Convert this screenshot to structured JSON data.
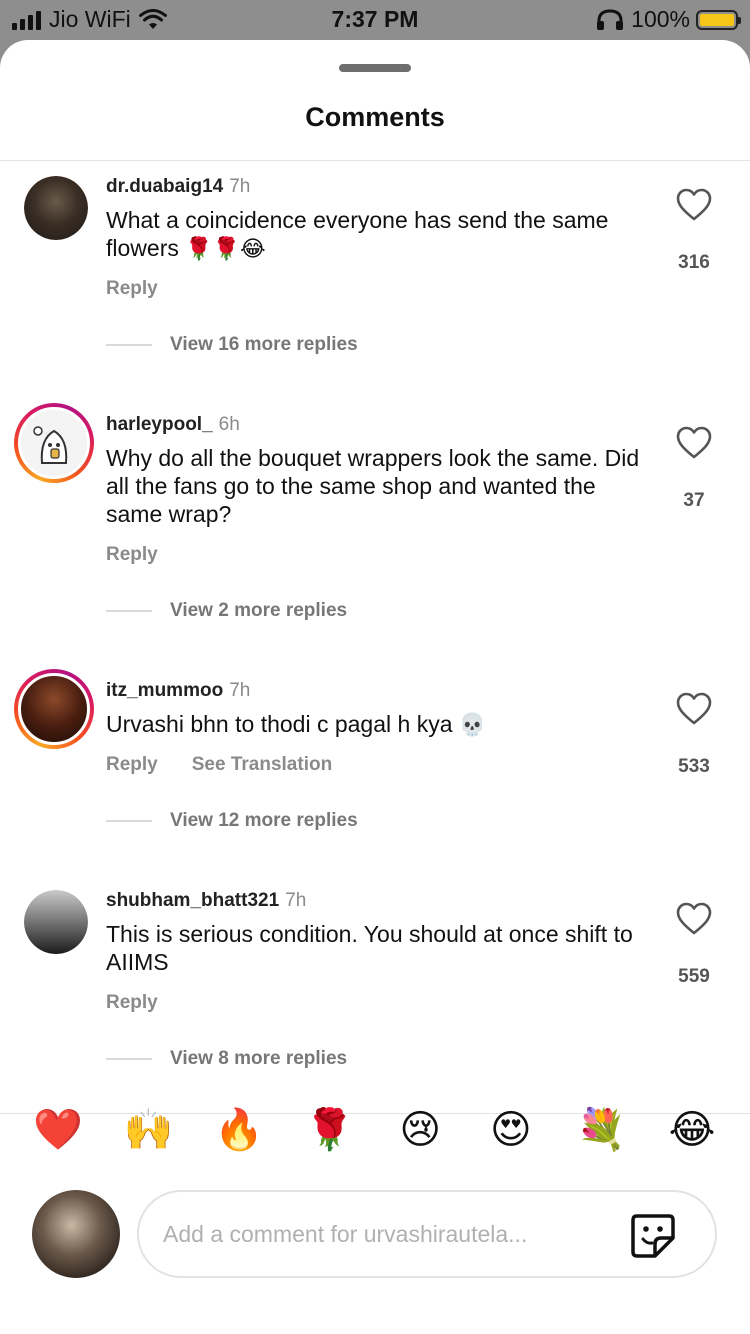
{
  "status_bar": {
    "carrier": "Jio WiFi",
    "time": "7:37 PM",
    "battery": "100%",
    "battery_color": "#f5c518"
  },
  "sheet": {
    "title": "Comments"
  },
  "comments": [
    {
      "user": "dr.duabaig14",
      "time": "7h",
      "text": "What a coincidence everyone has  send the same flowers",
      "emojis": "🌹🌹😂",
      "reply_label": "Reply",
      "likes": "316",
      "view_replies": "View 16 more replies",
      "has_story_ring": false
    },
    {
      "user": "harleypool_",
      "time": "6h",
      "text": "Why do all the bouquet wrappers look the same. Did all the fans go to the same shop and wanted the same wrap?",
      "emojis": "",
      "reply_label": "Reply",
      "likes": "37",
      "view_replies": "View 2 more replies",
      "has_story_ring": true
    },
    {
      "user": "itz_mummoo",
      "time": "7h",
      "text": "Urvashi bhn to thodi c pagal h kya",
      "emojis": "💀",
      "reply_label": "Reply",
      "translation_label": "See Translation",
      "likes": "533",
      "view_replies": "View 12 more replies",
      "has_story_ring": true
    },
    {
      "user": "shubham_bhatt321",
      "time": "7h",
      "text": "This is serious condition. You should at once shift to AIIMS",
      "emojis": "",
      "reply_label": "Reply",
      "likes": "559",
      "view_replies": "View 8 more replies",
      "has_story_ring": false
    }
  ],
  "quick_reactions": [
    "❤️",
    "🙌",
    "🔥",
    "🌹",
    "😢",
    "😍",
    "💐",
    "😂"
  ],
  "composer": {
    "placeholder": "Add a comment for urvashirautela..."
  },
  "icons": {
    "like": "heart-outline-icon",
    "sticker": "sticker-icon",
    "wifi": "wifi-icon",
    "headphones": "headphones-icon"
  }
}
